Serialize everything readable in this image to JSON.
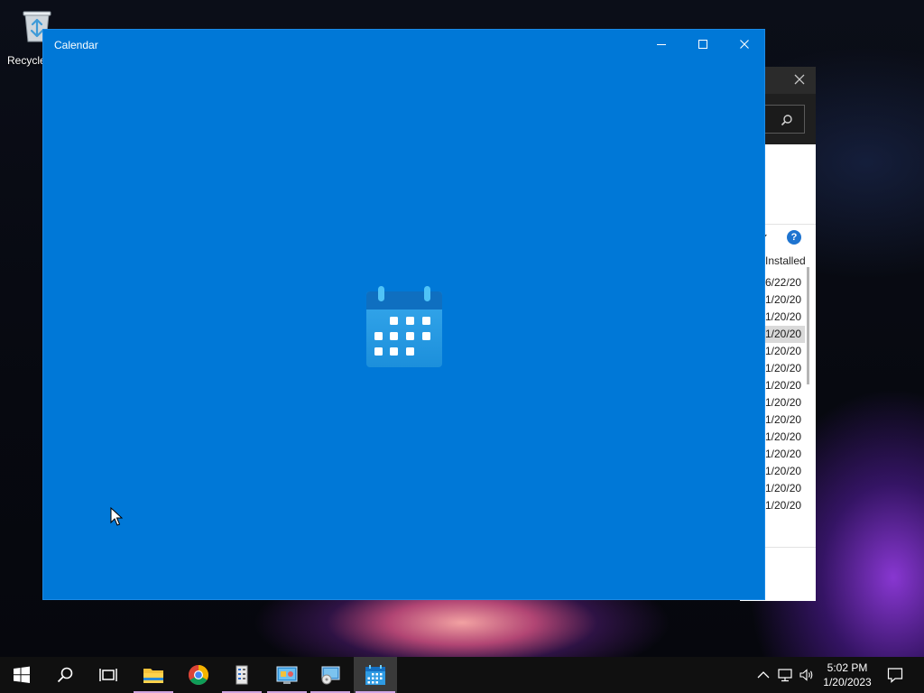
{
  "desktop": {
    "recycle_bin_label": "Recycle"
  },
  "background_window": {
    "column_header": "Installed",
    "help_glyph": "?",
    "rows": [
      "6/22/20",
      "1/20/20",
      "1/20/20",
      "1/20/20",
      "1/20/20",
      "1/20/20",
      "1/20/20",
      "1/20/20",
      "1/20/20",
      "1/20/20",
      "1/20/20",
      "1/20/20",
      "1/20/20",
      "1/20/20"
    ],
    "selected_row_index": 3
  },
  "calendar_window": {
    "title": "Calendar",
    "splash_icon": "calendar-app-icon",
    "background_color": "#0078d7"
  },
  "taskbar": {
    "buttons": [
      {
        "name": "start-button",
        "icon": "windows-logo-icon"
      },
      {
        "name": "search-button",
        "icon": "search-icon"
      },
      {
        "name": "task-view-button",
        "icon": "task-view-icon"
      },
      {
        "name": "file-explorer-button",
        "icon": "folder-icon"
      },
      {
        "name": "chrome-button",
        "icon": "chrome-icon"
      },
      {
        "name": "server-manager-button",
        "icon": "server-manager-icon"
      },
      {
        "name": "control-panel-button",
        "icon": "control-panel-icon"
      },
      {
        "name": "setup-button",
        "icon": "setup-icon"
      },
      {
        "name": "calendar-taskbar-button",
        "icon": "calendar-icon",
        "active": true
      }
    ],
    "clock": {
      "time": "5:02 PM",
      "date": "1/20/2023"
    }
  }
}
